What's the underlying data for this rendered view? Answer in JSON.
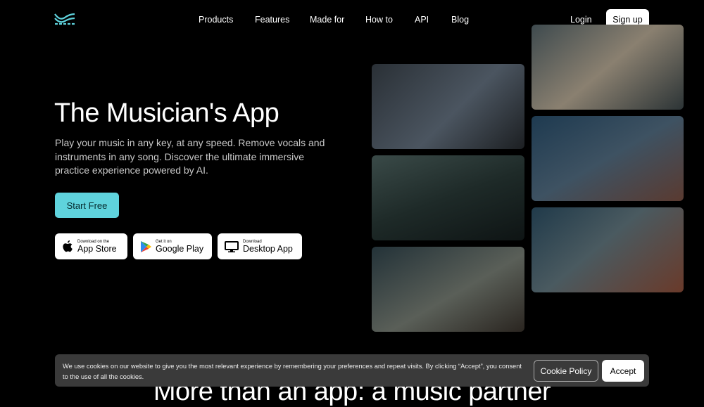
{
  "nav": {
    "items": [
      "Products",
      "Features",
      "Made for",
      "How to",
      "API",
      "Blog"
    ],
    "login": "Login",
    "signup": "Sign up"
  },
  "hero": {
    "title": "The Musician's App",
    "subtitle": "Play your music in any key, at any speed. Remove vocals and instruments in any song. Discover the ultimate immersive practice experience powered by AI.",
    "cta": "Start Free"
  },
  "stores": [
    {
      "small": "Download on the",
      "big": "App Store",
      "icon": "apple-icon"
    },
    {
      "small": "Get it on",
      "big": "Google Play",
      "icon": "google-play-icon"
    },
    {
      "small": "Download",
      "big": "Desktop App",
      "icon": "monitor-icon"
    }
  ],
  "section_heading": "More than an app: a music partner",
  "cookie": {
    "text": "We use cookies on our website to give you the most relevant experience by remembering your preferences and repeat visits. By clicking “Accept”, you consent to the use of all the cookies.",
    "policy": "Cookie Policy",
    "accept": "Accept"
  },
  "colors": {
    "accent": "#5fd3dd",
    "background": "#000000"
  }
}
